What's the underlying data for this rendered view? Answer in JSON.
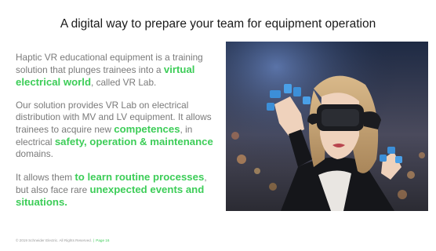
{
  "slide": {
    "title": "A digital way to prepare your team for equipment operation",
    "paragraphs": [
      {
        "segments": [
          {
            "text": "Haptic VR educational equipment is a training solution that plunges trainees into a ",
            "highlight": false
          },
          {
            "text": "virtual electrical world",
            "highlight": true
          },
          {
            "text": ", called VR Lab.",
            "highlight": false
          }
        ]
      },
      {
        "segments": [
          {
            "text": "Our solution provides VR Lab on electrical distribution with MV and LV equipment. It allows trainees to acquire new ",
            "highlight": false
          },
          {
            "text": "competences",
            "highlight": true
          },
          {
            "text": ", in electrical ",
            "highlight": false
          },
          {
            "text": "safety, operation & maintenance",
            "highlight": true
          },
          {
            "text": " domains.",
            "highlight": false
          }
        ]
      },
      {
        "segments": [
          {
            "text": "It allows them ",
            "highlight": false
          },
          {
            "text": "to learn routine processes",
            "highlight": true
          },
          {
            "text": ", but also face rare ",
            "highlight": false
          },
          {
            "text": "unexpected events and situations.",
            "highlight": true
          }
        ]
      }
    ],
    "footer": {
      "copyright": "© 2019 Schneider Electric. All Rights Reserved.",
      "separator": "|",
      "page": "Page 16"
    },
    "colors": {
      "accent": "#3dcd58",
      "body_text": "#7a7a7a",
      "title_text": "#1a1a1a"
    }
  }
}
